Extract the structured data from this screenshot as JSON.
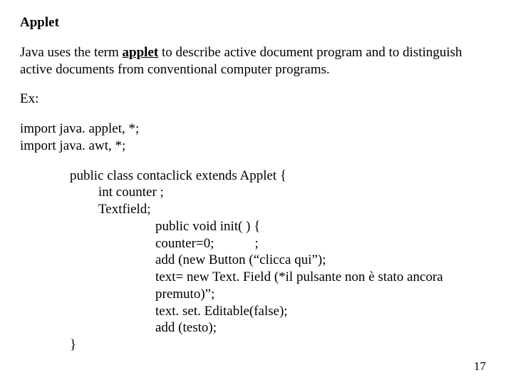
{
  "heading": "Applet",
  "paragraph": {
    "p1_pre": "Java uses the term ",
    "p1_bold": "applet",
    "p1_post": " to describe active document program and to distinguish",
    "p2": "active documents from conventional computer programs."
  },
  "ex_label": "Ex:",
  "imports": {
    "line1": "import java. applet, *;",
    "line2": "import java. awt, *;"
  },
  "code": {
    "l1": "public class contaclick extends Applet {",
    "l2": "int counter ;",
    "l3": "Textfield;",
    "l4": "public void init( ) {",
    "l5": "counter=0;            ;",
    "l6": "add (new Button (“clicca qui”);",
    "l7": "text= new Text. Field (*il pulsante non è stato ancora premuto)”;",
    "l8": "text. set. Editable(false);",
    "l9": "add (testo);",
    "l10": "}"
  },
  "page_number": "17"
}
